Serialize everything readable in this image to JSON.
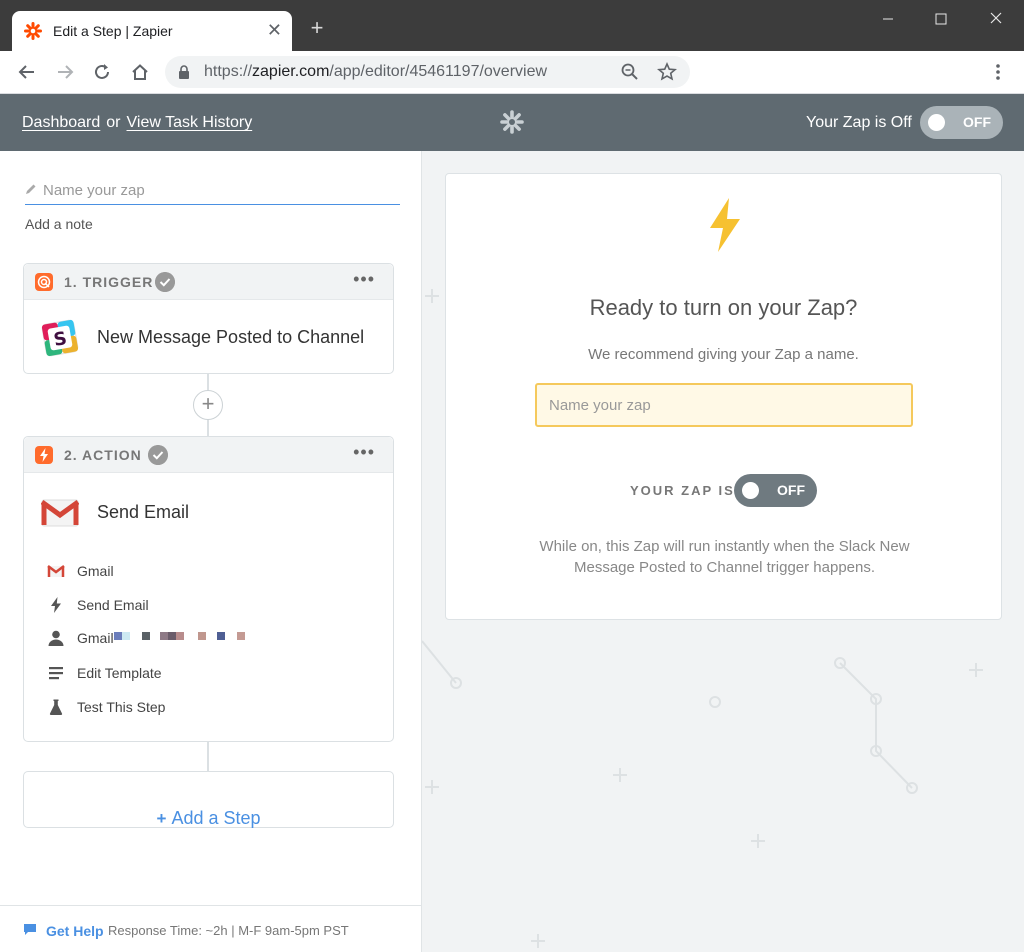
{
  "browser": {
    "tab_title": "Edit a Step | Zapier",
    "new_tab_symbol": "+",
    "url_prefix": "https://",
    "url_host": "zapier.com",
    "url_path": "/app/editor/45461197/overview"
  },
  "header": {
    "dashboard_link": "Dashboard",
    "or_text": "or",
    "task_history_link": "View Task History",
    "zap_status_text": "Your Zap is Off",
    "toggle_label": "OFF"
  },
  "editor": {
    "name_placeholder": "Name your zap",
    "add_note": "Add a note",
    "trigger": {
      "step_label": "1. TRIGGER",
      "menu": "•••",
      "app_title": "New Message Posted to Channel",
      "icon": "slack-icon"
    },
    "add_step_symbol": "+",
    "action": {
      "step_label": "2. ACTION",
      "menu": "•••",
      "app_title": "Send Email",
      "icon": "gmail-icon",
      "items": [
        {
          "label": "Gmail",
          "icon": "gmail-icon"
        },
        {
          "label": "Send Email",
          "icon": "bolt-icon"
        },
        {
          "label": "Gmail",
          "icon": "user-icon"
        },
        {
          "label": "Edit Template",
          "icon": "list-icon"
        },
        {
          "label": "Test This Step",
          "icon": "flask-icon"
        }
      ]
    },
    "add_a_step": "Add a Step"
  },
  "help": {
    "get_help": "Get Help",
    "response_time": "Response Time: ~2h | M-F 9am-5pm PST"
  },
  "ready_panel": {
    "heading": "Ready to turn on your Zap?",
    "recommend": "We recommend giving your Zap a name.",
    "name_placeholder": "Name your zap",
    "your_zap_is": "YOUR ZAP IS",
    "toggle_label": "OFF",
    "description": "While on, this Zap will run instantly when the Slack New Message Posted to Channel trigger happens."
  },
  "colors": {
    "header_bg": "#5f6a71",
    "accent_blue": "#4a90e2",
    "zapier_orange": "#ff4a00",
    "bolt_yellow": "#f6c131"
  }
}
